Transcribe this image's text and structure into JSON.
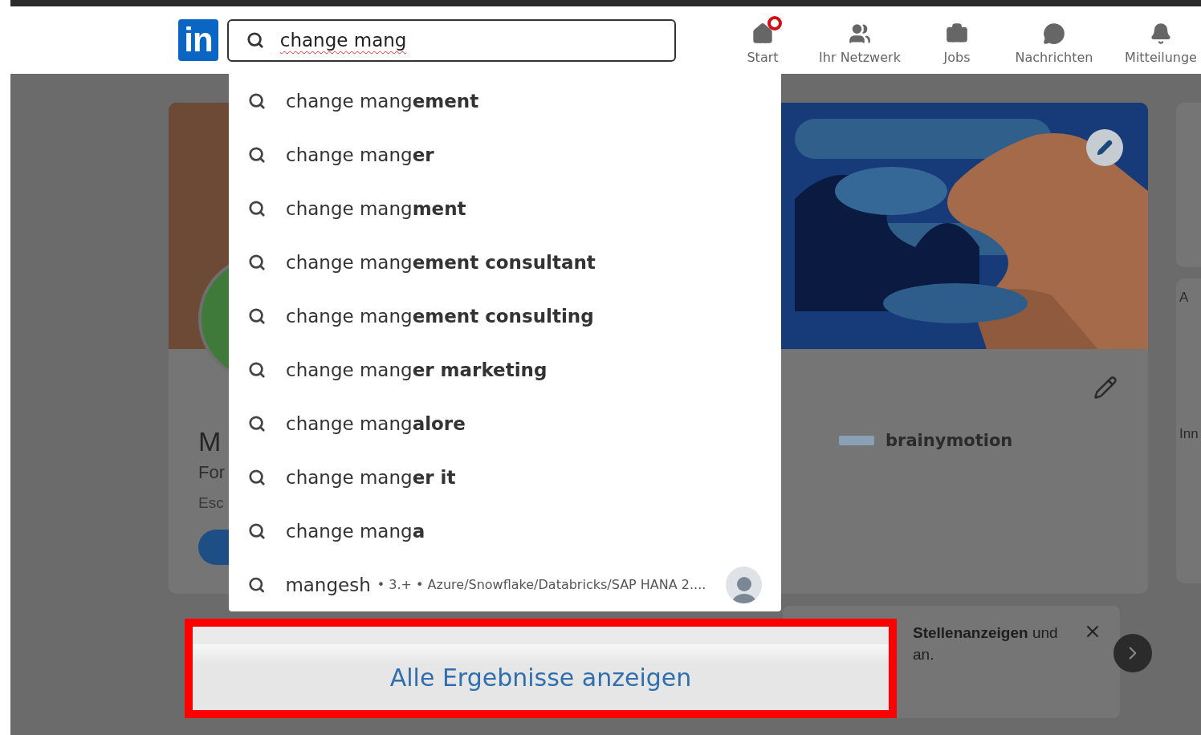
{
  "header": {
    "logo": "in",
    "search": {
      "value": "change mang"
    },
    "nav": [
      {
        "kind": "home",
        "label": "Start",
        "badge": true
      },
      {
        "kind": "network",
        "label": "Ihr Netzwerk",
        "badge": false
      },
      {
        "kind": "jobs",
        "label": "Jobs",
        "badge": false
      },
      {
        "kind": "messages",
        "label": "Nachrichten",
        "badge": false
      },
      {
        "kind": "bell",
        "label": "Mitteilunge",
        "badge": false
      }
    ]
  },
  "profile": {
    "name": "M",
    "headline": "For",
    "location": "Esc",
    "company": "brainymotion"
  },
  "sidebar": {
    "texts": [
      "A",
      "Inn"
    ]
  },
  "job_card": {
    "text": "**Stellenanzeigen** und",
    "text_2": "an."
  },
  "suggestions": [
    {
      "kind": "query",
      "text": "change mang**ement**"
    },
    {
      "kind": "query",
      "text": "change mang**er**"
    },
    {
      "kind": "query",
      "text": "change mang**ment**"
    },
    {
      "kind": "query",
      "text": "change mang**ement consultant**"
    },
    {
      "kind": "query",
      "text": "change mang**ement consulting**"
    },
    {
      "kind": "query",
      "text": "change mang**er marketing**"
    },
    {
      "kind": "query",
      "text": "change mang**alore**"
    },
    {
      "kind": "query",
      "text": "change mang**er it**"
    },
    {
      "kind": "query",
      "text": "change mang**a**"
    },
    {
      "kind": "person",
      "text": "mangesh",
      "detail": "• 3.+ • Azure/Snowflake/Databricks/SAP HANA 2...."
    }
  ],
  "show_all_button": "Alle Ergebnisse anzeigen"
}
